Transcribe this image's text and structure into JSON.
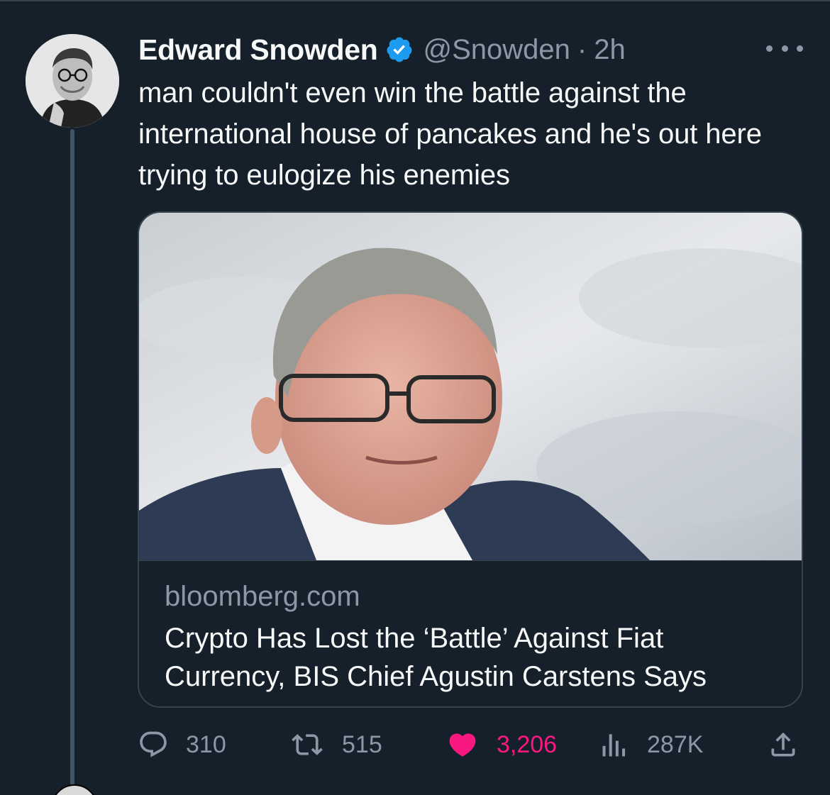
{
  "tweet": {
    "author": {
      "display_name": "Edward Snowden",
      "handle": "@Snowden",
      "verified": true,
      "avatar_icon": "author-avatar-photo"
    },
    "separator": "·",
    "timestamp": "2h",
    "text": "man couldn't even win the battle against the international house of pancakes and he's out here trying to eulogize his enemies",
    "more_icon": "more-horizontal-icon",
    "link_card": {
      "image_icon": "article-photo",
      "domain": "bloomberg.com",
      "title": "Crypto Has Lost the ‘Battle’ Against Fiat Currency, BIS Chief Agustin Carstens Says"
    },
    "actions": {
      "replies": {
        "icon": "reply-icon",
        "count": "310"
      },
      "retweets": {
        "icon": "retweet-icon",
        "count": "515"
      },
      "likes": {
        "icon": "heart-filled-icon",
        "count": "3,206",
        "liked": true
      },
      "views": {
        "icon": "views-icon",
        "count": "287K"
      },
      "share": {
        "icon": "share-icon"
      }
    }
  },
  "colors": {
    "background": "#15202b",
    "text": "#f7f9f9",
    "secondary_text": "#8b98a5",
    "border": "#38444d",
    "verified_blue": "#1d9bf0",
    "like_pink": "#f91880"
  }
}
